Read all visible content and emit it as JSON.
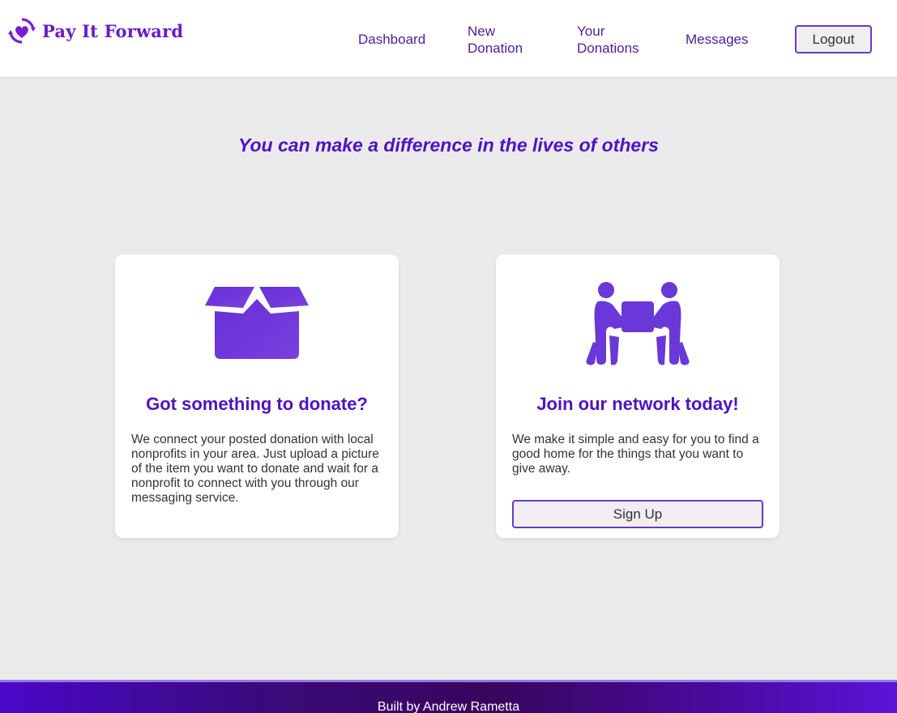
{
  "brand": {
    "name": "Pay It Forward",
    "icon": "heart-cycle-icon",
    "color": "#6a1bc8"
  },
  "nav": {
    "dashboard": "Dashboard",
    "new_donation_1": "New",
    "new_donation_2": "Donation",
    "your_donations_1": "Your",
    "your_donations_2": "Donations",
    "messages": "Messages",
    "logout": "Logout"
  },
  "tagline": "You can make a difference in the lives of others",
  "cards": [
    {
      "icon": "open-box-icon",
      "title": "Got something to donate?",
      "text": "We connect your posted donation with local nonprofits in your area. Just upload a picture of the item you want to donate and wait for a nonprofit to connect with you through our messaging service."
    },
    {
      "icon": "people-carrying-box-icon",
      "title": "Join our network today!",
      "text": "We make it simple and easy for you to find a good home for the things that you want to give away.",
      "button": "Sign Up"
    }
  ],
  "footer": {
    "text": "Built by Andrew Rametta"
  },
  "colors": {
    "accent": "#4f12c2",
    "icon": "#6a38d8",
    "background": "#ecebec"
  }
}
